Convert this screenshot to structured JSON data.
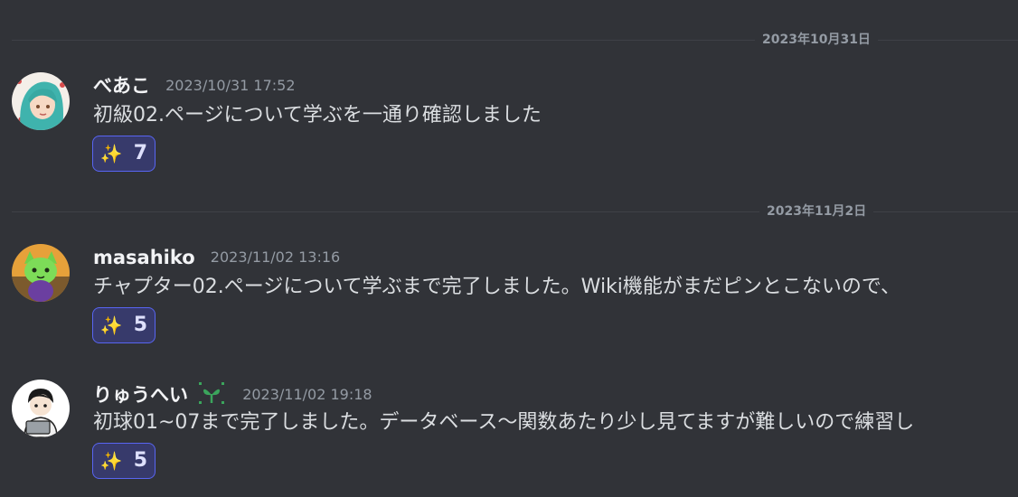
{
  "dividers": [
    {
      "date": "2023年10月31日"
    },
    {
      "date": "2023年11月2日"
    }
  ],
  "messages": [
    {
      "username": "べあこ",
      "timestamp": "2023/10/31 17:52",
      "content": "初級02.ページについて学ぶを一通り確認しました",
      "reaction": {
        "emoji": "✨",
        "count": "7"
      }
    },
    {
      "username": "masahiko",
      "timestamp": "2023/11/02 13:16",
      "content": "チャプター02.ページについて学ぶまで完了しました。Wiki機能がまだピンとこないので、",
      "reaction": {
        "emoji": "✨",
        "count": "5"
      }
    },
    {
      "username": "りゅうへい",
      "badge": "sprout-icon",
      "timestamp": "2023/11/02 19:18",
      "content": "初球01~07まで完了しました。データベース〜関数あたり少し見てますが難しいので練習し",
      "reaction": {
        "emoji": "✨",
        "count": "5"
      }
    }
  ]
}
